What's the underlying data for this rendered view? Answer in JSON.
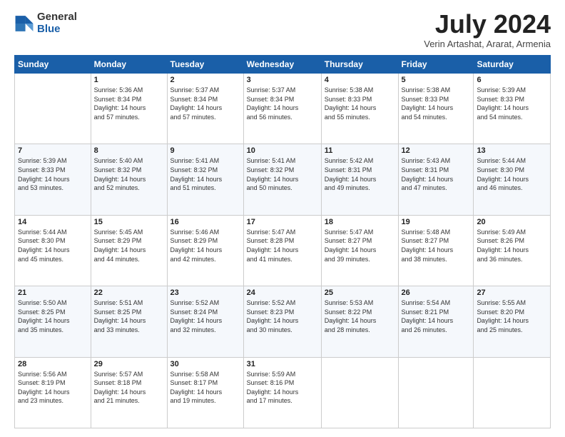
{
  "logo": {
    "line1": "General",
    "line2": "Blue"
  },
  "title": "July 2024",
  "location": "Verin Artashat, Ararat, Armenia",
  "days_of_week": [
    "Sunday",
    "Monday",
    "Tuesday",
    "Wednesday",
    "Thursday",
    "Friday",
    "Saturday"
  ],
  "weeks": [
    [
      {
        "day": "",
        "info": ""
      },
      {
        "day": "1",
        "info": "Sunrise: 5:36 AM\nSunset: 8:34 PM\nDaylight: 14 hours\nand 57 minutes."
      },
      {
        "day": "2",
        "info": "Sunrise: 5:37 AM\nSunset: 8:34 PM\nDaylight: 14 hours\nand 57 minutes."
      },
      {
        "day": "3",
        "info": "Sunrise: 5:37 AM\nSunset: 8:34 PM\nDaylight: 14 hours\nand 56 minutes."
      },
      {
        "day": "4",
        "info": "Sunrise: 5:38 AM\nSunset: 8:33 PM\nDaylight: 14 hours\nand 55 minutes."
      },
      {
        "day": "5",
        "info": "Sunrise: 5:38 AM\nSunset: 8:33 PM\nDaylight: 14 hours\nand 54 minutes."
      },
      {
        "day": "6",
        "info": "Sunrise: 5:39 AM\nSunset: 8:33 PM\nDaylight: 14 hours\nand 54 minutes."
      }
    ],
    [
      {
        "day": "7",
        "info": "Sunrise: 5:39 AM\nSunset: 8:33 PM\nDaylight: 14 hours\nand 53 minutes."
      },
      {
        "day": "8",
        "info": "Sunrise: 5:40 AM\nSunset: 8:32 PM\nDaylight: 14 hours\nand 52 minutes."
      },
      {
        "day": "9",
        "info": "Sunrise: 5:41 AM\nSunset: 8:32 PM\nDaylight: 14 hours\nand 51 minutes."
      },
      {
        "day": "10",
        "info": "Sunrise: 5:41 AM\nSunset: 8:32 PM\nDaylight: 14 hours\nand 50 minutes."
      },
      {
        "day": "11",
        "info": "Sunrise: 5:42 AM\nSunset: 8:31 PM\nDaylight: 14 hours\nand 49 minutes."
      },
      {
        "day": "12",
        "info": "Sunrise: 5:43 AM\nSunset: 8:31 PM\nDaylight: 14 hours\nand 47 minutes."
      },
      {
        "day": "13",
        "info": "Sunrise: 5:44 AM\nSunset: 8:30 PM\nDaylight: 14 hours\nand 46 minutes."
      }
    ],
    [
      {
        "day": "14",
        "info": "Sunrise: 5:44 AM\nSunset: 8:30 PM\nDaylight: 14 hours\nand 45 minutes."
      },
      {
        "day": "15",
        "info": "Sunrise: 5:45 AM\nSunset: 8:29 PM\nDaylight: 14 hours\nand 44 minutes."
      },
      {
        "day": "16",
        "info": "Sunrise: 5:46 AM\nSunset: 8:29 PM\nDaylight: 14 hours\nand 42 minutes."
      },
      {
        "day": "17",
        "info": "Sunrise: 5:47 AM\nSunset: 8:28 PM\nDaylight: 14 hours\nand 41 minutes."
      },
      {
        "day": "18",
        "info": "Sunrise: 5:47 AM\nSunset: 8:27 PM\nDaylight: 14 hours\nand 39 minutes."
      },
      {
        "day": "19",
        "info": "Sunrise: 5:48 AM\nSunset: 8:27 PM\nDaylight: 14 hours\nand 38 minutes."
      },
      {
        "day": "20",
        "info": "Sunrise: 5:49 AM\nSunset: 8:26 PM\nDaylight: 14 hours\nand 36 minutes."
      }
    ],
    [
      {
        "day": "21",
        "info": "Sunrise: 5:50 AM\nSunset: 8:25 PM\nDaylight: 14 hours\nand 35 minutes."
      },
      {
        "day": "22",
        "info": "Sunrise: 5:51 AM\nSunset: 8:25 PM\nDaylight: 14 hours\nand 33 minutes."
      },
      {
        "day": "23",
        "info": "Sunrise: 5:52 AM\nSunset: 8:24 PM\nDaylight: 14 hours\nand 32 minutes."
      },
      {
        "day": "24",
        "info": "Sunrise: 5:52 AM\nSunset: 8:23 PM\nDaylight: 14 hours\nand 30 minutes."
      },
      {
        "day": "25",
        "info": "Sunrise: 5:53 AM\nSunset: 8:22 PM\nDaylight: 14 hours\nand 28 minutes."
      },
      {
        "day": "26",
        "info": "Sunrise: 5:54 AM\nSunset: 8:21 PM\nDaylight: 14 hours\nand 26 minutes."
      },
      {
        "day": "27",
        "info": "Sunrise: 5:55 AM\nSunset: 8:20 PM\nDaylight: 14 hours\nand 25 minutes."
      }
    ],
    [
      {
        "day": "28",
        "info": "Sunrise: 5:56 AM\nSunset: 8:19 PM\nDaylight: 14 hours\nand 23 minutes."
      },
      {
        "day": "29",
        "info": "Sunrise: 5:57 AM\nSunset: 8:18 PM\nDaylight: 14 hours\nand 21 minutes."
      },
      {
        "day": "30",
        "info": "Sunrise: 5:58 AM\nSunset: 8:17 PM\nDaylight: 14 hours\nand 19 minutes."
      },
      {
        "day": "31",
        "info": "Sunrise: 5:59 AM\nSunset: 8:16 PM\nDaylight: 14 hours\nand 17 minutes."
      },
      {
        "day": "",
        "info": ""
      },
      {
        "day": "",
        "info": ""
      },
      {
        "day": "",
        "info": ""
      }
    ]
  ]
}
